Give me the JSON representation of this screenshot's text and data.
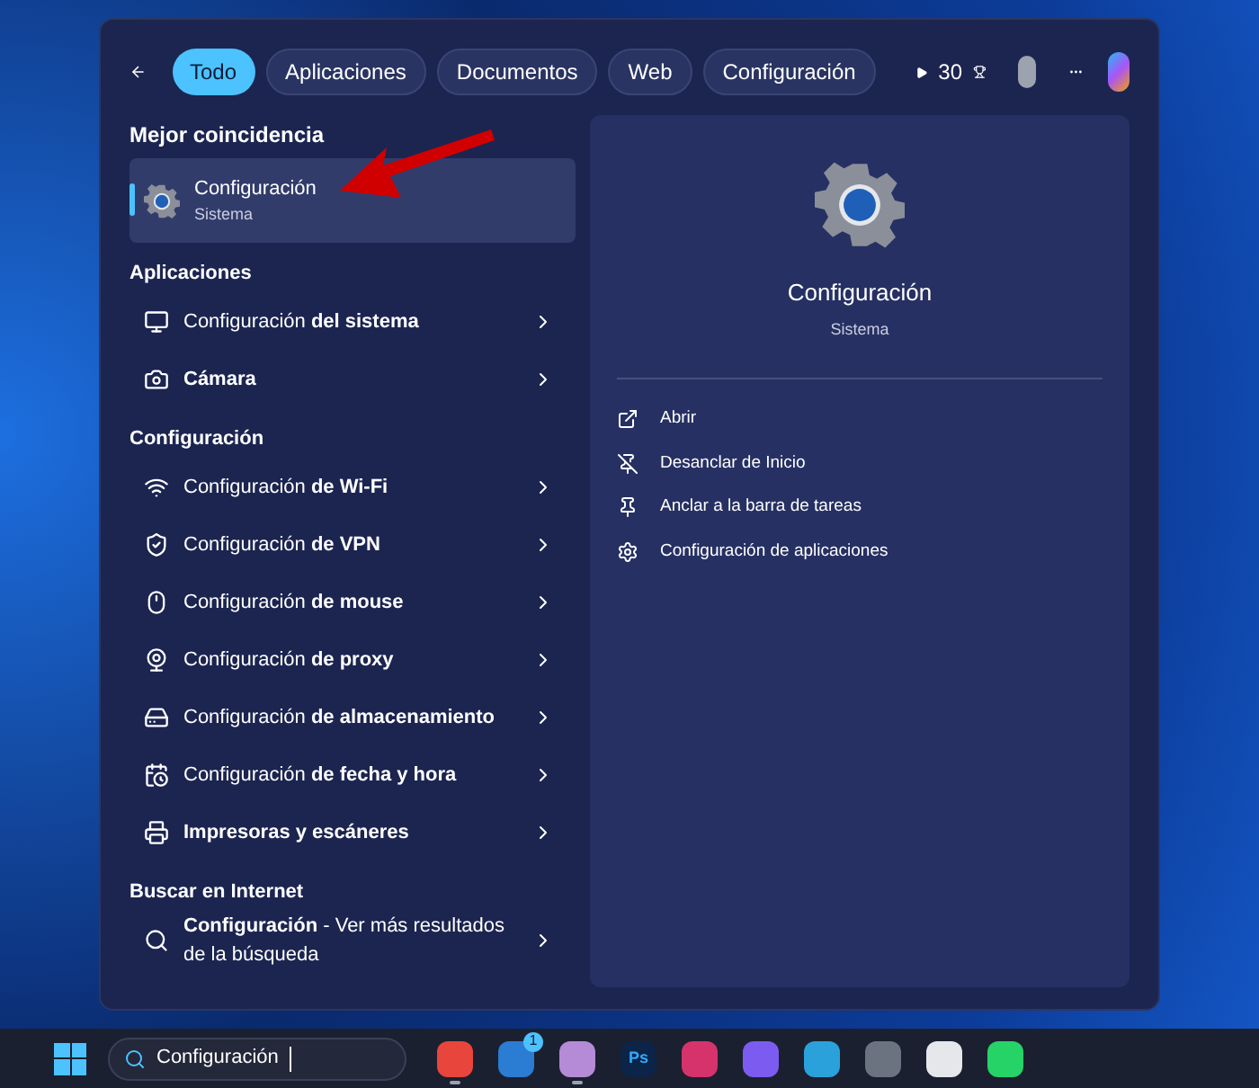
{
  "filters": [
    {
      "label": "Todo",
      "selected": true
    },
    {
      "label": "Aplicaciones",
      "selected": false
    },
    {
      "label": "Documentos",
      "selected": false
    },
    {
      "label": "Web",
      "selected": false
    },
    {
      "label": "Configuración",
      "selected": false
    }
  ],
  "points": "30",
  "best_match": {
    "heading": "Mejor coincidencia",
    "title": "Configuración",
    "subtitle": "Sistema",
    "selected": true
  },
  "sections": [
    {
      "heading": "Aplicaciones",
      "items": [
        {
          "label": "Configuración **del sistema**"
        },
        {
          "label": "**Cámara**"
        }
      ]
    },
    {
      "heading": "Configuración",
      "items": [
        {
          "label": "Configuración **de Wi-Fi**"
        },
        {
          "label": "Configuración **de VPN**"
        },
        {
          "label": "Configuración **de mouse**"
        },
        {
          "label": "Configuración **de proxy**"
        },
        {
          "label": "Configuración **de almacenamiento**"
        },
        {
          "label": "Configuración **de fecha y hora**"
        },
        {
          "label": "**Impresoras y escáneres**"
        }
      ]
    },
    {
      "heading": "Buscar en Internet",
      "items": [
        {
          "label": "**Configuración** - Ver más resultados de la búsqueda"
        }
      ]
    }
  ],
  "preview": {
    "title": "Configuración",
    "subtitle": "Sistema",
    "actions": [
      "Abrir",
      "Desanclar de Inicio",
      "Anclar a la barra de tareas",
      "Configuración de aplicaciones"
    ]
  },
  "taskbar": {
    "search_value": "Configuración",
    "apps": [
      {
        "running": true
      },
      {
        "running": false,
        "badge": "1"
      },
      {
        "running": true
      },
      {
        "running": false,
        "label": "Ps"
      },
      {
        "running": false
      },
      {
        "running": false
      },
      {
        "running": false
      },
      {
        "running": false
      },
      {
        "running": false
      },
      {
        "running": false
      }
    ]
  }
}
